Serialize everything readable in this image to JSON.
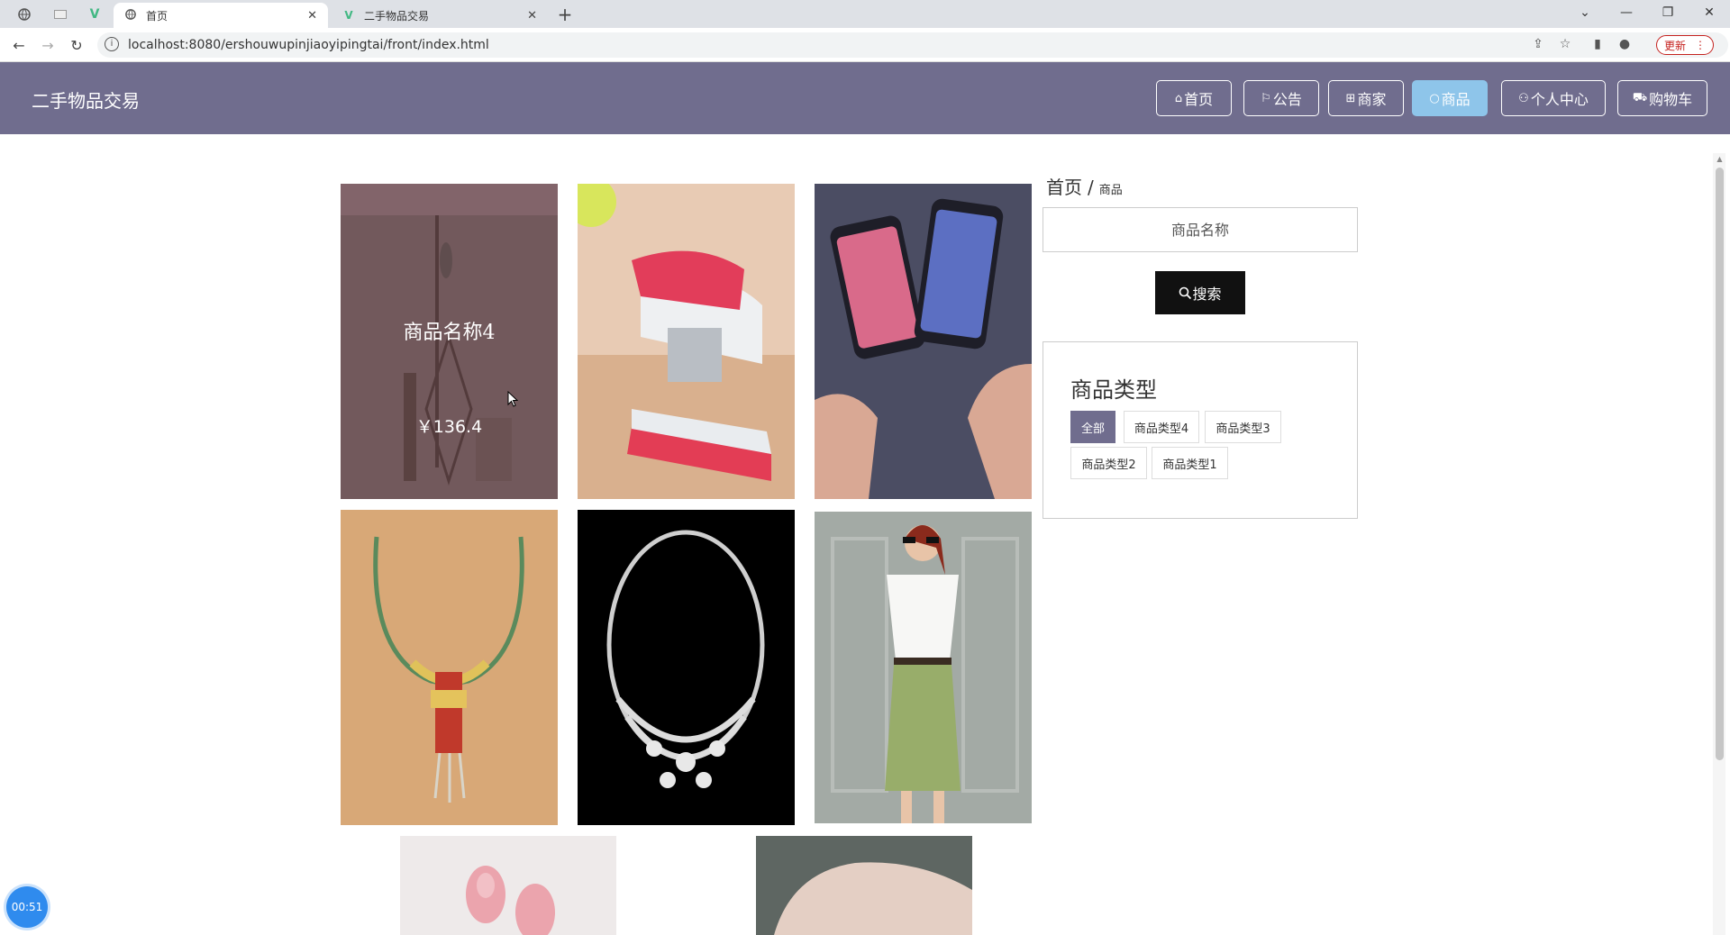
{
  "browser": {
    "tabs": [
      {
        "title": "首页"
      },
      {
        "title": "二手物品交易"
      }
    ],
    "url": "localhost:8080/ershouwupinjiaoyipingtai/front/index.html",
    "update_label": "更新"
  },
  "site": {
    "title": "二手物品交易",
    "nav": [
      {
        "label": "首页",
        "icon": "home-icon"
      },
      {
        "label": "公告",
        "icon": "flag-icon"
      },
      {
        "label": "商家",
        "icon": "gift-icon"
      },
      {
        "label": "商品",
        "icon": "circle-icon",
        "active": true
      },
      {
        "label": "个人中心",
        "icon": "user-icon"
      },
      {
        "label": "购物车",
        "icon": "cart-icon"
      }
    ]
  },
  "products": [
    {
      "name": "商品名称4",
      "price": "￥136.4"
    }
  ],
  "sidebar": {
    "breadcrumb_home": "首页",
    "breadcrumb_sep": "/",
    "breadcrumb_current": "商品",
    "search_placeholder": "商品名称",
    "search_label": "搜索",
    "category_title": "商品类型",
    "categories": [
      "全部",
      "商品类型4",
      "商品类型3",
      "商品类型2",
      "商品类型1"
    ]
  },
  "timer": "00:51",
  "colors": {
    "header": "#706d8e",
    "nav_active": "#8ec5ea",
    "chip_active": "#706d8e",
    "search_button": "#111111"
  }
}
